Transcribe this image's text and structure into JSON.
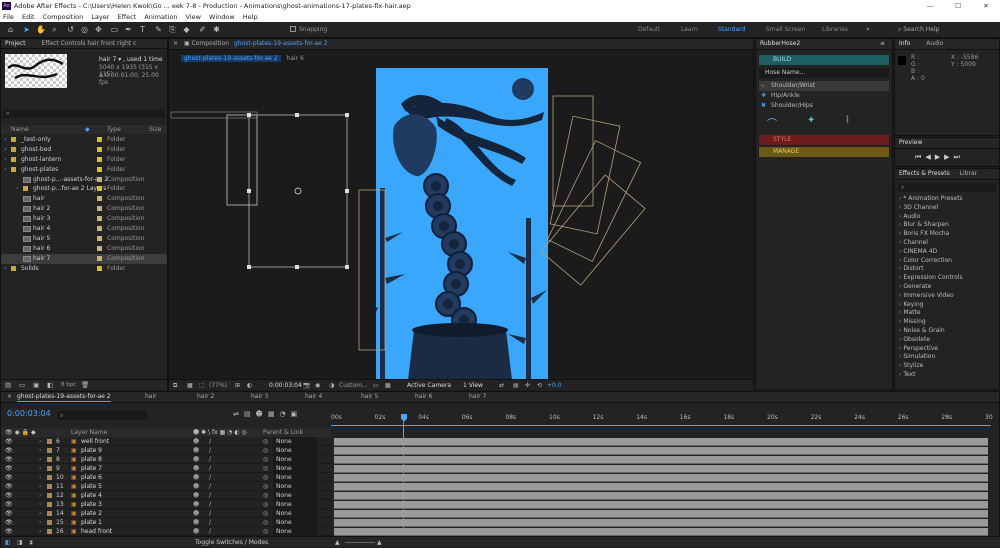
{
  "titlebar": {
    "app_icon": "Ae",
    "title": "Adobe After Effects - C:\\Users\\Helen Kwok\\Go ... eek 7-8 - Production - Animations\\ghost-animations-17-plates-fix-hair.aep",
    "minimize": "—",
    "maximize": "☐",
    "close": "✕"
  },
  "menu": [
    "File",
    "Edit",
    "Composition",
    "Layer",
    "Effect",
    "Animation",
    "View",
    "Window",
    "Help"
  ],
  "toolbar": {
    "snapping": "Snapping",
    "workspaces": [
      "Default",
      "Learn",
      "Standard",
      "Small Screen",
      "Libraries"
    ],
    "search_placeholder": "Search Help"
  },
  "project": {
    "tab": "Project",
    "effect_controls_tab": "Effect Controls hair front right c",
    "selected_name": "hair 7 ▾ , used 1 time",
    "selected_dims": "5040 x 1935 (315 x 115)",
    "selected_duration": "Δ 0:00:01:00, 25.00 fps",
    "col_name": "Name",
    "col_type": "Type",
    "col_size": "Size",
    "bpc": "8 bpc",
    "items": [
      {
        "name": "_test-only",
        "type": "Folder",
        "indent": 0,
        "kind": "folder"
      },
      {
        "name": "ghost-bed",
        "type": "Folder",
        "indent": 0,
        "kind": "folder"
      },
      {
        "name": "ghost-lantern",
        "type": "Folder",
        "indent": 0,
        "kind": "folder"
      },
      {
        "name": "ghost-plates",
        "type": "Folder",
        "indent": 0,
        "kind": "folder"
      },
      {
        "name": "ghost-p...-assets-for-ae 2",
        "type": "Composition",
        "indent": 1,
        "kind": "comp"
      },
      {
        "name": "ghost-p...for-ae 2 Layers",
        "type": "Folder",
        "indent": 1,
        "kind": "folder"
      },
      {
        "name": "hair",
        "type": "Composition",
        "indent": 1,
        "kind": "comp"
      },
      {
        "name": "hair 2",
        "type": "Composition",
        "indent": 1,
        "kind": "comp"
      },
      {
        "name": "hair 3",
        "type": "Composition",
        "indent": 1,
        "kind": "comp"
      },
      {
        "name": "hair 4",
        "type": "Composition",
        "indent": 1,
        "kind": "comp"
      },
      {
        "name": "hair 5",
        "type": "Composition",
        "indent": 1,
        "kind": "comp"
      },
      {
        "name": "hair 6",
        "type": "Composition",
        "indent": 1,
        "kind": "comp"
      },
      {
        "name": "hair 7",
        "type": "Composition",
        "indent": 1,
        "kind": "comp"
      },
      {
        "name": "Solids",
        "type": "Folder",
        "indent": 0,
        "kind": "folder"
      }
    ]
  },
  "composition": {
    "tab_label": "Composition",
    "tab_name": "ghost-plates-19-assets-for-ae 2",
    "breadcrumbs": [
      "ghost-plates-19-assets-for-ae 2",
      "hair 6"
    ],
    "zoom": "(77%)",
    "timecode": "0:00:03:04",
    "camera": "Active Camera",
    "view": "1 View",
    "resolution": "Custom...",
    "exposure": "+0.0",
    "bg_color": "#3aa7ff"
  },
  "rubberhose": {
    "title": "RubberHose2",
    "build": "BUILD",
    "hose_placeholder": "Hose Name...",
    "options": [
      "Shoulder/Wrist",
      "Hip/Ankle",
      "Shoulder/Hips"
    ],
    "style": "STYLE",
    "manage": "MANAGE"
  },
  "info": {
    "tab": "Info",
    "audio_tab": "Audio",
    "r": "R :",
    "g": "G :",
    "b": "B :",
    "a": "A : 0",
    "x": "X : -5586",
    "y": "Y : 5009"
  },
  "preview": {
    "tab": "Preview"
  },
  "effects": {
    "tab": "Effects & Presets",
    "lib_tab": "Librar",
    "items": [
      "* Animation Presets",
      "3D Channel",
      "Audio",
      "Blur & Sharpen",
      "Boris FX Mocha",
      "Channel",
      "CINEMA 4D",
      "Color Correction",
      "Distort",
      "Expression Controls",
      "Generate",
      "Immersive Video",
      "Keying",
      "Matte",
      "Missing",
      "Noise & Grain",
      "Obsolete",
      "Perspective",
      "Simulation",
      "Stylize",
      "Text"
    ]
  },
  "timeline": {
    "tabs": [
      "ghost-plates-19-assets-for-ae 2",
      "hair",
      "hair 2",
      "hair 3",
      "hair 4",
      "hair 5",
      "hair 6",
      "hair 7"
    ],
    "timecode": "0:00:03:04",
    "col_layer": "Layer Name",
    "col_parent": "Parent & Link",
    "ruler": [
      "00s",
      "02s",
      "04s",
      "06s",
      "08s",
      "10s",
      "12s",
      "14s",
      "16s",
      "18s",
      "20s",
      "22s",
      "24s",
      "26s",
      "28s",
      "30"
    ],
    "toggle": "Toggle Switches / Modes",
    "layers": [
      {
        "num": "6",
        "name": "well front"
      },
      {
        "num": "7",
        "name": "plate 9"
      },
      {
        "num": "8",
        "name": "plate 8"
      },
      {
        "num": "9",
        "name": "plate 7"
      },
      {
        "num": "10",
        "name": "plate 6"
      },
      {
        "num": "11",
        "name": "plate 5"
      },
      {
        "num": "12",
        "name": "plate 4"
      },
      {
        "num": "13",
        "name": "plate 3"
      },
      {
        "num": "14",
        "name": "plate 2"
      },
      {
        "num": "15",
        "name": "plate 1"
      },
      {
        "num": "16",
        "name": "head front"
      }
    ],
    "parent": "None"
  }
}
